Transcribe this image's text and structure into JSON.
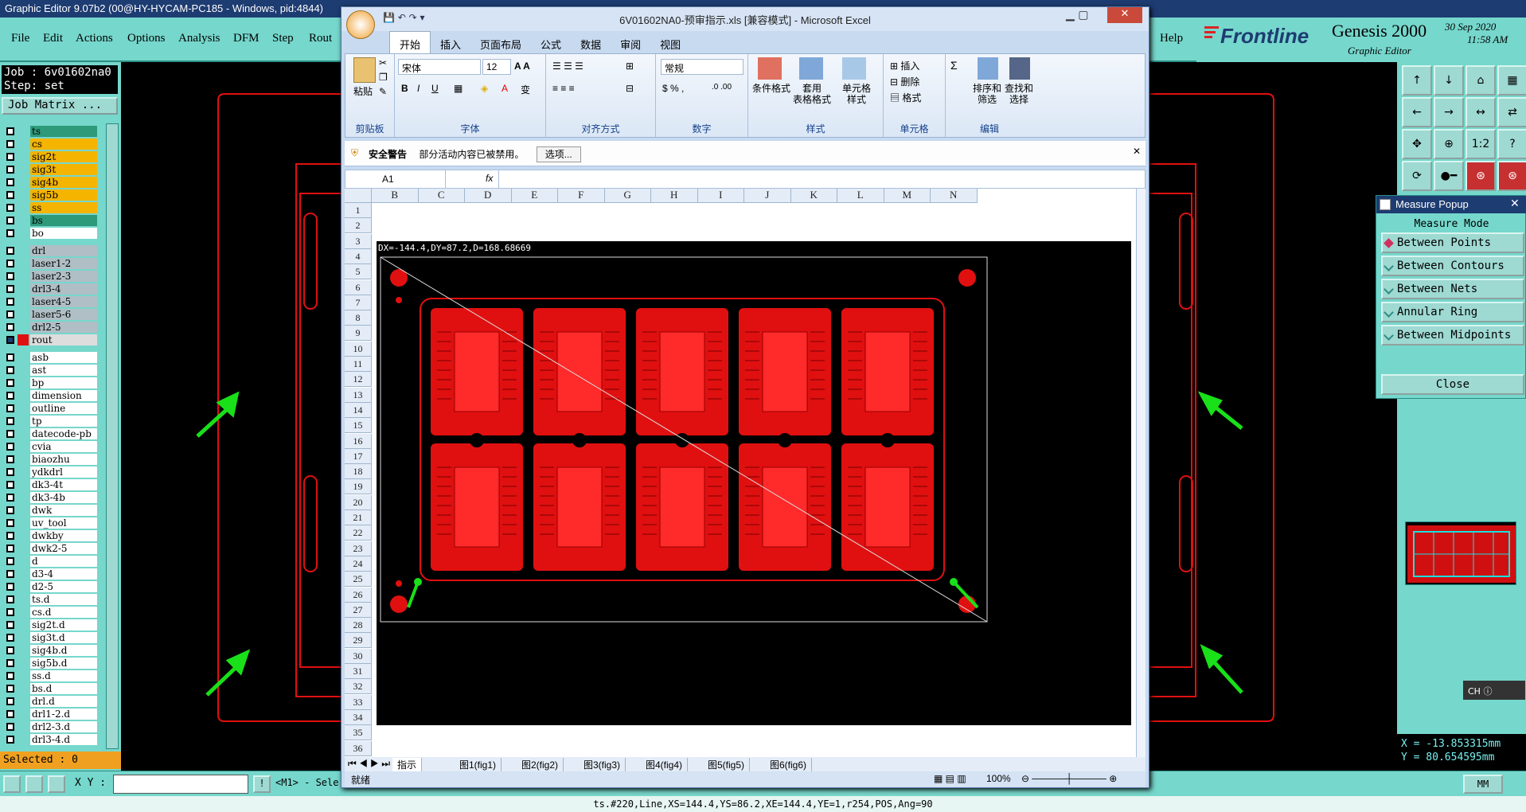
{
  "app_title": "Graphic Editor 9.07b2 (00@HY-HYCAM-PC185 - Windows, pid:4844)",
  "menu": [
    "File",
    "Edit",
    "Actions",
    "Options",
    "Analysis",
    "DFM",
    "Step",
    "Rout",
    "Help"
  ],
  "brand": {
    "logo": "Frontline",
    "product": "Genesis 2000",
    "subtitle": "Graphic Editor",
    "date": "30 Sep 2020",
    "time": "11:58 AM"
  },
  "job": {
    "job_line": "Job : 6v01602na0",
    "step_line": "Step: set",
    "matrix_button": "Job Matrix ..."
  },
  "layers_group1": [
    {
      "name": "ts",
      "color": "#2e9a7a"
    },
    {
      "name": "cs",
      "color": "#f4b400"
    },
    {
      "name": "sig2t",
      "color": "#f4b400"
    },
    {
      "name": "sig3t",
      "color": "#f4b400"
    },
    {
      "name": "sig4b",
      "color": "#f4b400"
    },
    {
      "name": "sig5b",
      "color": "#f4b400"
    },
    {
      "name": "ss",
      "color": "#f4b400"
    },
    {
      "name": "bs",
      "color": "#2e9a7a"
    },
    {
      "name": "bo",
      "color": "#ffffff"
    }
  ],
  "layers_group2": [
    {
      "name": "drl",
      "color": "#b0bec5"
    },
    {
      "name": "laser1-2",
      "color": "#b0bec5"
    },
    {
      "name": "laser2-3",
      "color": "#b0bec5"
    },
    {
      "name": "drl3-4",
      "color": "#b0bec5"
    },
    {
      "name": "laser4-5",
      "color": "#b0bec5"
    },
    {
      "name": "laser5-6",
      "color": "#b0bec5"
    },
    {
      "name": "drl2-5",
      "color": "#b0bec5"
    },
    {
      "name": "rout",
      "color": "#dddddd",
      "active": true
    }
  ],
  "layers_group3": [
    "asb",
    "ast",
    "bp",
    "dimension",
    "outline",
    "tp",
    "datecode-pb",
    "cvia",
    "biaozhu",
    "ydkdrl",
    "dk3-4t",
    "dk3-4b",
    "dwk",
    "uv_tool",
    "dwkby",
    "dwk2-5",
    "d",
    "d3-4",
    "d2-5",
    "ts.d",
    "cs.d",
    "sig2t.d",
    "sig3t.d",
    "sig4b.d",
    "sig5b.d",
    "ss.d",
    "bs.d",
    "drl.d",
    "drl1-2.d",
    "drl2-3.d",
    "drl3-4.d"
  ],
  "selected": "Selected : 0",
  "xy_label": "X Y :",
  "hint": "<M1> - Sele",
  "status_line": "ts.#220,Line,XS=144.4,YS=86.2,XE=144.4,YE=1,r254,POS,Ang=90",
  "units_button": "MM",
  "coords": {
    "x": "X = -13.853315mm",
    "y": "Y = 80.654595mm"
  },
  "right_tools": [
    "↑",
    "↓",
    "⌂",
    "▦",
    "←",
    "→",
    "↔",
    "⇄",
    "✥",
    "⊕",
    "1:2",
    "?",
    "⟳",
    "●━",
    "⊛",
    "⊛"
  ],
  "measure": {
    "title": "Measure Popup",
    "mode_label": "Measure Mode",
    "options": [
      "Between Points",
      "Between Contours",
      "Between Nets",
      "Annular Ring",
      "Between Midpoints"
    ],
    "selected": 0,
    "close": "Close"
  },
  "ch_label": "CH",
  "excel": {
    "title": "6V01602NA0-预审指示.xls  [兼容模式] - Microsoft Excel",
    "tabs": [
      "开始",
      "插入",
      "页面布局",
      "公式",
      "数据",
      "审阅",
      "视图"
    ],
    "paste": "粘贴",
    "font_name": "宋体",
    "font_size": "12",
    "number_format": "常规",
    "groups": [
      "剪贴板",
      "字体",
      "对齐方式",
      "数字",
      "样式",
      "单元格",
      "编辑"
    ],
    "style_buttons": [
      "条件格式",
      "套用\n表格格式",
      "单元格\n样式"
    ],
    "cell_buttons": [
      "插入",
      "删除",
      "格式"
    ],
    "edit_buttons": [
      "排序和\n筛选",
      "查找和\n选择"
    ],
    "security_title": "安全警告",
    "security_text": "部分活动内容已被禁用。",
    "security_button": "选项...",
    "name_box": "A1",
    "fx": "fx",
    "columns": [
      "B",
      "C",
      "D",
      "E",
      "F",
      "G",
      "H",
      "I",
      "J",
      "K",
      "L",
      "M",
      "N"
    ],
    "rows": [
      "1",
      "2",
      "3",
      "4",
      "5",
      "6",
      "7",
      "8",
      "9",
      "10",
      "11",
      "12",
      "13",
      "14",
      "15",
      "16",
      "17",
      "18",
      "19",
      "20",
      "21",
      "22",
      "23",
      "24",
      "25",
      "26",
      "27",
      "28",
      "29",
      "30",
      "31",
      "32",
      "33",
      "34",
      "35",
      "36"
    ],
    "measure_text": "DX=-144.4,DY=87.2,D=168.68669",
    "sheet_tabs": [
      "指示",
      "图1(fig1)",
      "图2(fig2)",
      "图3(fig3)",
      "图4(fig4)",
      "图5(fig5)",
      "图6(fig6)"
    ],
    "status_ready": "就绪",
    "zoom": "100%"
  }
}
